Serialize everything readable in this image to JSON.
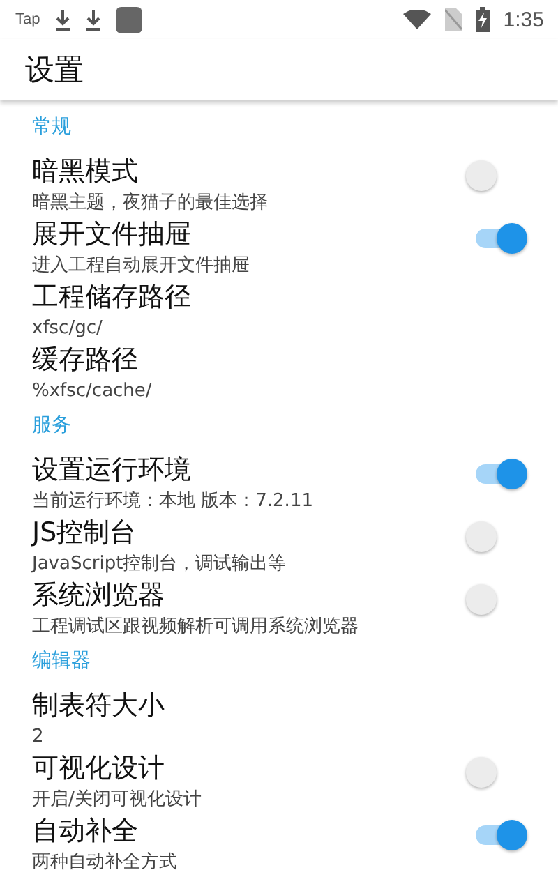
{
  "status_bar": {
    "app_label": "Tap",
    "time": "1:35"
  },
  "app_bar": {
    "title": "设置"
  },
  "sections": [
    {
      "header": "常规",
      "items": [
        {
          "kind": "switch",
          "title": "暗黑模式",
          "summary": "暗黑主题，夜猫子的最佳选择",
          "on": false
        },
        {
          "kind": "switch",
          "title": "展开文件抽屉",
          "summary": "进入工程自动展开文件抽屉",
          "on": true
        },
        {
          "kind": "text",
          "title": "工程储存路径",
          "summary": "xfsc/gc/"
        },
        {
          "kind": "text",
          "title": "缓存路径",
          "summary": "%xfsc/cache/"
        }
      ]
    },
    {
      "header": "服务",
      "items": [
        {
          "kind": "switch",
          "title": "设置运行环境",
          "summary": "当前运行环境：本地 版本：7.2.11",
          "on": true
        },
        {
          "kind": "switch",
          "title": "JS控制台",
          "summary": "JavaScript控制台，调试输出等",
          "on": false
        },
        {
          "kind": "switch",
          "title": "系统浏览器",
          "summary": "工程调试区跟视频解析可调用系统浏览器",
          "on": false
        }
      ]
    },
    {
      "header": "编辑器",
      "items": [
        {
          "kind": "text",
          "title": "制表符大小",
          "summary": "2"
        },
        {
          "kind": "switch",
          "title": "可视化设计",
          "summary": "开启/关闭可视化设计",
          "on": false
        },
        {
          "kind": "switch",
          "title": "自动补全",
          "summary": "两种自动补全方式",
          "on": true
        }
      ]
    }
  ]
}
